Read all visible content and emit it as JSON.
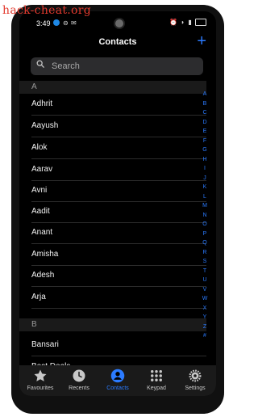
{
  "watermark": "hack-cheat.org",
  "status_bar": {
    "time": "3:49"
  },
  "header": {
    "title": "Contacts",
    "add_label": "+"
  },
  "search": {
    "placeholder": "Search"
  },
  "sections": [
    {
      "letter": "A",
      "contacts": [
        "Adhrit",
        "Aayush",
        "Alok",
        "Aarav",
        "Avni",
        "Aadit",
        "Anant",
        "Amisha",
        "Adesh",
        "Arja"
      ]
    },
    {
      "letter": "B",
      "contacts": [
        "Bansari",
        "Best Deals"
      ]
    }
  ],
  "index_letters": [
    "A",
    "B",
    "C",
    "D",
    "E",
    "F",
    "G",
    "H",
    "I",
    "J",
    "K",
    "L",
    "M",
    "N",
    "O",
    "P",
    "Q",
    "R",
    "S",
    "T",
    "U",
    "V",
    "W",
    "X",
    "Y",
    "Z",
    "#"
  ],
  "tabs": [
    {
      "label": "Favourites",
      "icon": "star-icon",
      "active": false
    },
    {
      "label": "Recents",
      "icon": "clock-icon",
      "active": false
    },
    {
      "label": "Contacts",
      "icon": "person-icon",
      "active": true
    },
    {
      "label": "Keypad",
      "icon": "keypad-icon",
      "active": false
    },
    {
      "label": "Settings",
      "icon": "gear-icon",
      "active": false
    }
  ],
  "colors": {
    "accent": "#2b7bff",
    "background": "#000000",
    "watermark": "#e33a2e"
  }
}
